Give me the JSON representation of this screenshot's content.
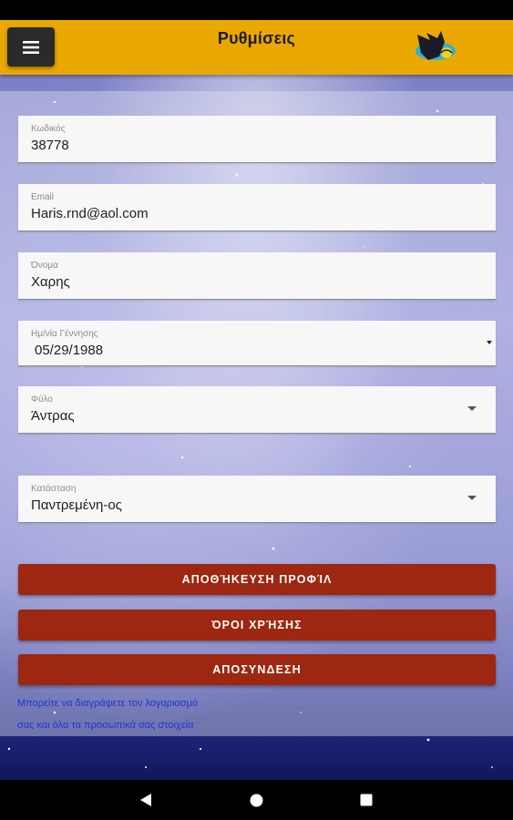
{
  "app": {
    "title": "Ρυθμίσεις"
  },
  "icons": {
    "menu": "hamburger-menu-icon",
    "logo": "app-logo-icon",
    "dropdown": "caret-down-icon"
  },
  "colors": {
    "appbar": "#eba800",
    "button": "#9d2710",
    "link": "#2233d8"
  },
  "fields": {
    "code": {
      "label": "Κωδικός",
      "value": "38778"
    },
    "email": {
      "label": "Email",
      "value": "Haris.rnd@aol.com"
    },
    "name": {
      "label": "Όνομα",
      "value": "Χαρης"
    },
    "birthdate": {
      "label": "Ημ/νία Γέννησης",
      "value": "05/29/1988"
    },
    "gender": {
      "label": "Φύλο",
      "value": "Άντρας"
    },
    "status": {
      "label": "Κατάσταση",
      "value": "Παντρεμένη-ος"
    }
  },
  "buttons": {
    "save": "ΑΠΟΘΉΚΕΥΣΗ ΠΡΟΦΊΛ",
    "terms": "ΌΡΟΙ ΧΡΉΣΗΣ",
    "logout": "ΑΠΟΣΥΝΔΕΣΗ"
  },
  "delete_account": {
    "line1": "Μπορείτε να διαγράψετε τον λογαριασμό",
    "line2": "σας και όλα τα προσωπικά σας στοιχεία"
  }
}
